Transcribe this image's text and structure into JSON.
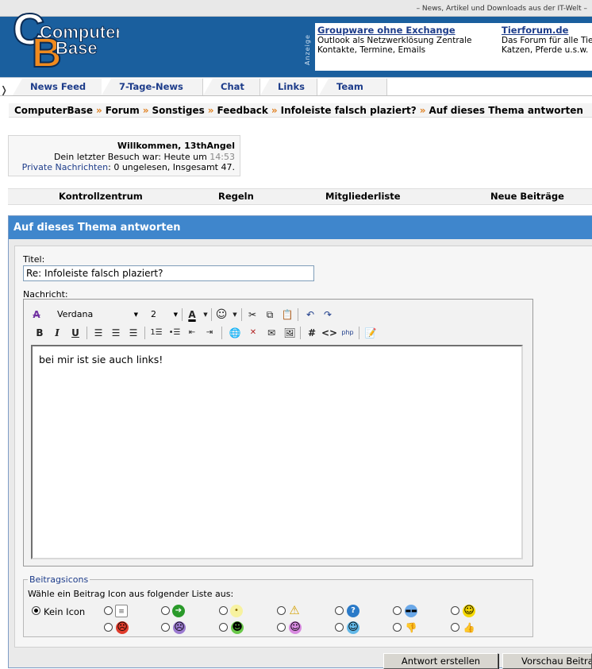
{
  "header": {
    "tagline": "– News, Artikel und Downloads aus der IT-Welt –",
    "logo_line1": "Computer",
    "logo_line2": "Base",
    "ad_label": "Anzeige",
    "ads": [
      {
        "title": "Groupware ohne Exchange",
        "line1": "Outlook als Netzwerklösung Zentrale",
        "line2": "Kontakte, Termine, Emails"
      },
      {
        "title": "Tierforum.de",
        "line1": "Das Forum für alle Tierfreunde",
        "line2": "Katzen, Pferde u.s.w."
      }
    ]
  },
  "nav": {
    "items": [
      "News Feed",
      "7-Tage-News",
      "Chat",
      "Links",
      "Team"
    ]
  },
  "breadcrumb": [
    "ComputerBase",
    "Forum",
    "Sonstiges",
    "Feedback",
    "Infoleiste falsch plaziert?",
    "Auf dieses Thema antworten"
  ],
  "welcome": {
    "greeting": "Willkommen, 13thAngel",
    "last_visit_prefix": "Dein letzter Besuch war: Heute um",
    "last_visit_time": "14:53",
    "pm_link": "Private Nachrichten",
    "pm_text": ": 0 ungelesen, Insgesamt 47."
  },
  "control_bar": [
    "Kontrollzentrum",
    "Regeln",
    "Mitgliederliste",
    "Neue Beiträge"
  ],
  "reply": {
    "heading": "Auf dieses Thema antworten",
    "title_label": "Titel:",
    "title_value": "Re: Infoleiste falsch plaziert?",
    "message_label": "Nachricht:",
    "font": "Verdana",
    "size": "2",
    "message_text": "bei mir ist sie auch links!"
  },
  "post_icons": {
    "legend": "Beitragsicons",
    "prompt": "Wähle ein Beitrag Icon aus folgender Liste aus:",
    "none_label": "Kein Icon",
    "icons": [
      "document-icon",
      "arrow-right-icon",
      "lightbulb-icon",
      "warning-icon",
      "question-icon",
      "cool-icon",
      "smile-icon",
      "angry-icon",
      "frown-icon",
      "grin-icon",
      "tongue-icon",
      "wink-icon",
      "thumbs-down-icon",
      "thumbs-up-icon"
    ]
  },
  "buttons": {
    "submit": "Antwort erstellen",
    "preview": "Vorschau Beitrag"
  },
  "colors": {
    "header_blue": "#1a5f9e",
    "panel_header": "#3f86cc",
    "link": "#1d3c8a",
    "crumb_arrow": "#e08020"
  }
}
